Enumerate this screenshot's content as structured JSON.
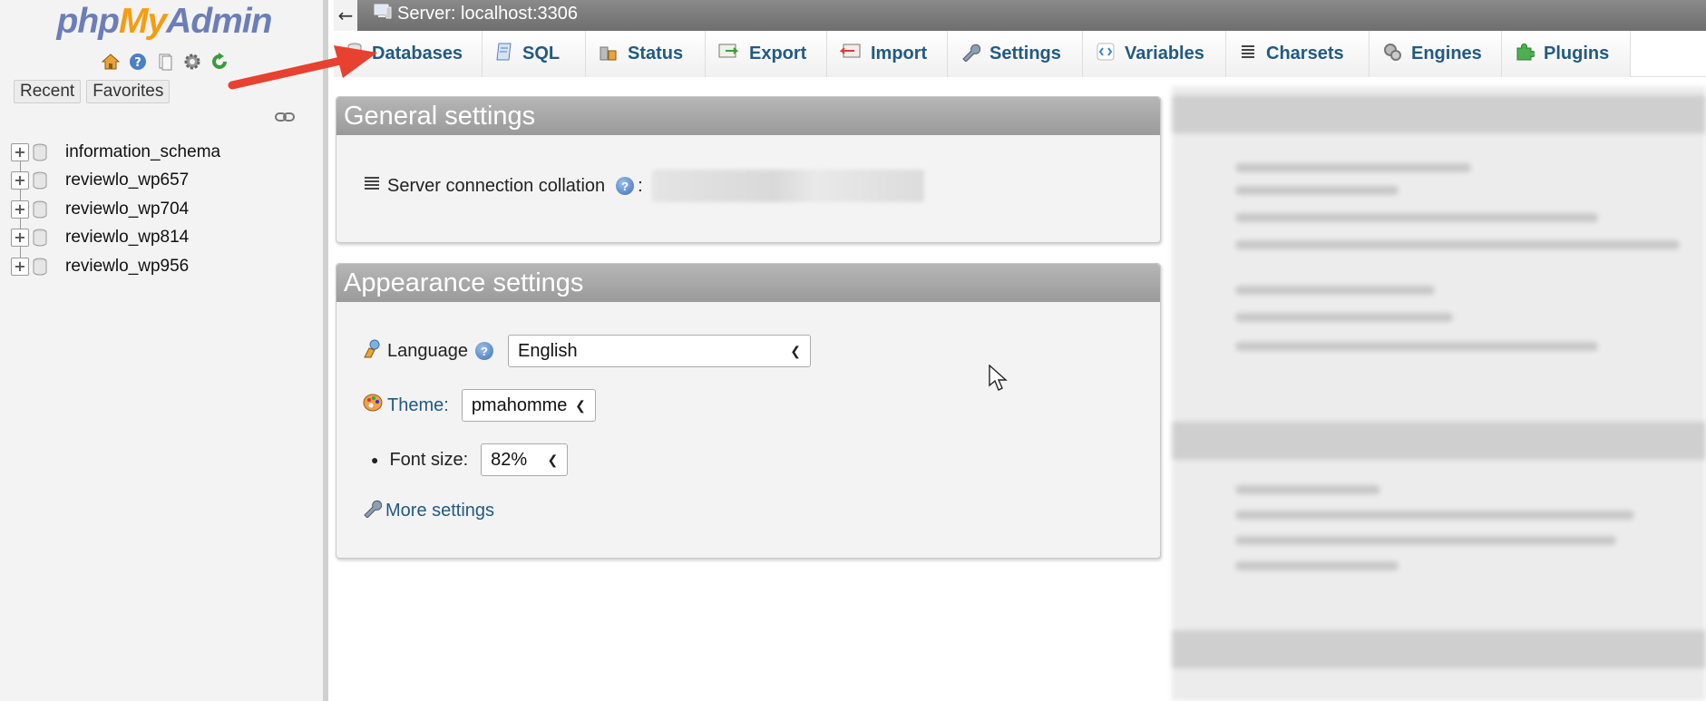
{
  "nav": {
    "logo": {
      "php": "php",
      "my": "My",
      "admin": "Admin"
    },
    "icons": [
      "home-icon",
      "help-icon",
      "docs-icon",
      "gear-icon",
      "reload-icon"
    ],
    "tabs": [
      {
        "label": "Recent"
      },
      {
        "label": "Favorites"
      }
    ],
    "databases": [
      {
        "name": "information_schema"
      },
      {
        "name": "reviewlo_wp657"
      },
      {
        "name": "reviewlo_wp704"
      },
      {
        "name": "reviewlo_wp814"
      },
      {
        "name": "reviewlo_wp956"
      }
    ]
  },
  "topbar": {
    "back": "←",
    "title": "Server: localhost:3306"
  },
  "menu": {
    "tabs": [
      {
        "label": "Databases",
        "icon": "databases-icon"
      },
      {
        "label": "SQL",
        "icon": "sql-icon"
      },
      {
        "label": "Status",
        "icon": "status-icon"
      },
      {
        "label": "Export",
        "icon": "export-icon"
      },
      {
        "label": "Import",
        "icon": "import-icon"
      },
      {
        "label": "Settings",
        "icon": "wrench-icon"
      },
      {
        "label": "Variables",
        "icon": "variables-icon"
      },
      {
        "label": "Charsets",
        "icon": "charsets-icon"
      },
      {
        "label": "Engines",
        "icon": "engines-icon"
      },
      {
        "label": "Plugins",
        "icon": "plugins-icon"
      }
    ]
  },
  "general": {
    "title": "General settings",
    "collation_label": "Server connection collation",
    "colon": ":"
  },
  "appearance": {
    "title": "Appearance settings",
    "language_label": "Language",
    "language_value": "English",
    "theme_label": "Theme:",
    "theme_value": "pmahomme",
    "fontsize_label": "Font size:",
    "fontsize_value": "82%",
    "more_settings": "More settings"
  },
  "colors": {
    "link": "#235a81",
    "annotation_arrow": "#e8412f",
    "panel_head": "#a8a8a8"
  }
}
